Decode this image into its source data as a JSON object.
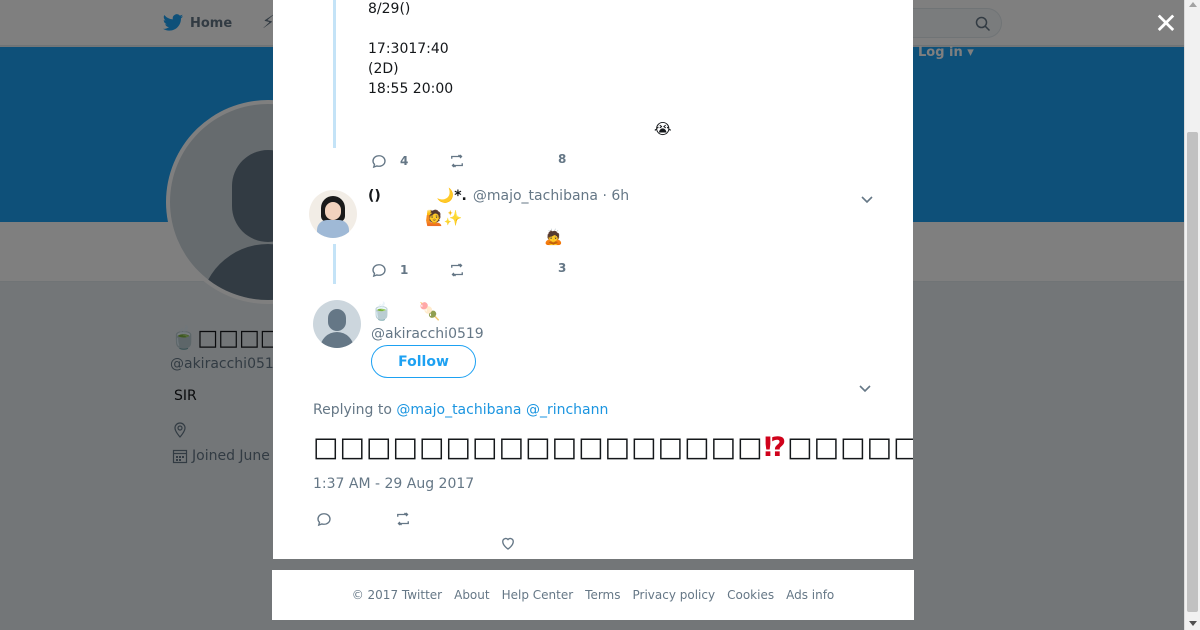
{
  "topbar": {
    "home_label": "Home",
    "login_label": "Log in ▾"
  },
  "profile_bg": {
    "name": "🍵□□□□□🍡",
    "handle": "@akiracchi0519",
    "bio": "SIR",
    "joined": "Joined June"
  },
  "thread": {
    "prev_tweet_lines": "8/29()\n\n17:3017:40\n(2D)\n18:55 20:00",
    "prev_tweet_emoji": "😭",
    "prev_actions": {
      "reply_count": "4",
      "like_count": "8"
    },
    "reply": {
      "name": "()",
      "name_extra": "🌙*.",
      "handle": "@majo_tachibana · 6h",
      "line1_emoji": "🙋✨",
      "line2_emoji": "🙇",
      "reply_count": "1",
      "like_count": "3"
    }
  },
  "main_tweet": {
    "display_name": "🍵     🍡",
    "handle": "@akiracchi0519",
    "follow_label": "Follow",
    "replying_prefix": "Replying to",
    "replying_users": [
      "@majo_tachibana",
      "@_rinchann"
    ],
    "text_part1": "□□□□□□□□□□□□□□□□□",
    "mark1": "⁉",
    "text_part2": "□□□□□□□□□□□□□□□",
    "mark2": "⁉",
    "text_part3": "(□)",
    "timestamp": "1:37 AM - 29 Aug 2017"
  },
  "footer": {
    "links": [
      "© 2017 Twitter",
      "About",
      "Help Center",
      "Terms",
      "Privacy policy",
      "Cookies",
      "Ads info"
    ]
  },
  "colors": {
    "accent": "#1da1f2",
    "banner": "#1da1f2",
    "mark": "#d0021b"
  },
  "icons": [
    "twitter-bird-icon",
    "search-icon",
    "close-icon",
    "reply-icon",
    "retweet-icon",
    "like-icon",
    "chevron-down-icon",
    "location-icon",
    "calendar-icon"
  ]
}
